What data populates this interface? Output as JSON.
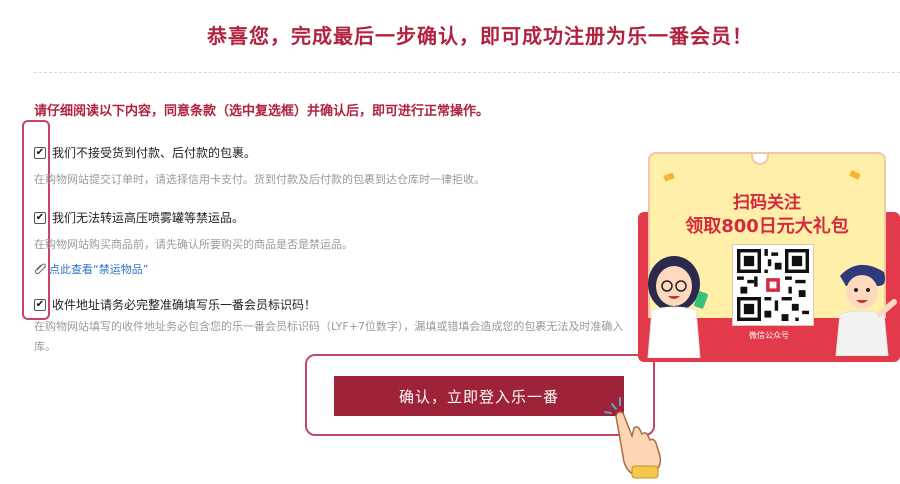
{
  "header": {
    "title": "恭喜您，完成最后一步确认，即可成功注册为乐一番会员！"
  },
  "notice": "请仔细阅读以下内容，同意条款（选中复选框）并确认后，即可进行正常操作。",
  "terms": [
    {
      "label": "我们不接受货到付款、后付款的包裹。",
      "desc": "在购物网站提交订单时，请选择信用卡支付。货到付款及后付款的包裹到达仓库时一律拒收。",
      "checked": "✔"
    },
    {
      "label": "我们无法转运高压喷雾罐等禁运品。",
      "desc": "在购物网站购买商品前，请先确认所要购买的商品是否是禁运品。",
      "link_prefix": "点此查看",
      "link_quoted": "“禁运物品”",
      "checked": "✔"
    },
    {
      "label": "收件地址请务必完整准确填写乐一番会员标识码！",
      "desc": "在购物网站填写的收件地址务必包含您的乐一番会员标识码（LYF+7位数字），漏填或错填会造成您的包裹无法及时准确入库。",
      "checked": "✔"
    }
  ],
  "confirm_button": "确认，立即登入乐一番",
  "promo": {
    "line1": "扫码关注",
    "line2": "领取800日元大礼包",
    "qr_caption": "微信公众号",
    "colors": {
      "red": "#e23a4b",
      "cream": "#ffefa9",
      "brand": "#b0223f"
    }
  },
  "icons": {
    "checkbox": "checkmark-icon",
    "link": "paperclip-icon",
    "hand": "pointing-hand-icon"
  }
}
